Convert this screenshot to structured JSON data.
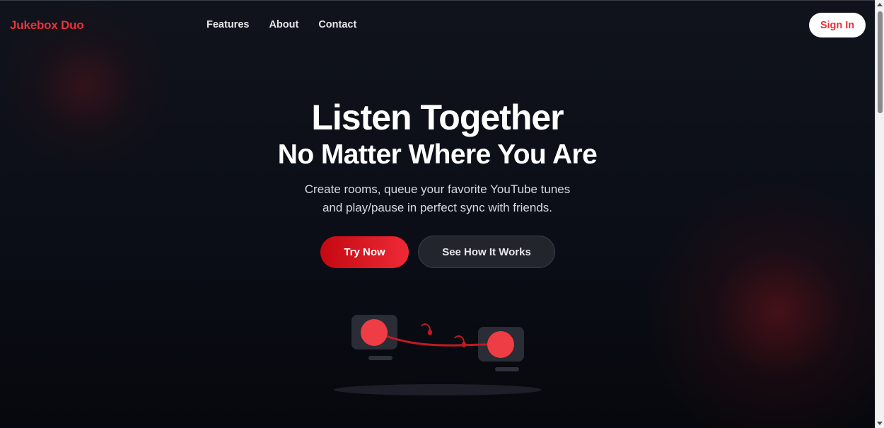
{
  "header": {
    "brand": "Jukebox Duo",
    "nav": [
      "Features",
      "About",
      "Contact"
    ],
    "sign_in": "Sign In"
  },
  "hero": {
    "title": "Listen Together",
    "subtitle": "No Matter Where You Are",
    "description_line1": "Create rooms, queue your favorite YouTube tunes",
    "description_line2": "and play/pause in perfect sync with friends.",
    "primary_cta": "Try Now",
    "secondary_cta": "See How It Works"
  },
  "colors": {
    "accent": "#e8323a",
    "background": "#0b0d14",
    "button_dark": "#22252c"
  },
  "icons": {
    "illustration": "two-devices-connected-by-music-wire"
  }
}
